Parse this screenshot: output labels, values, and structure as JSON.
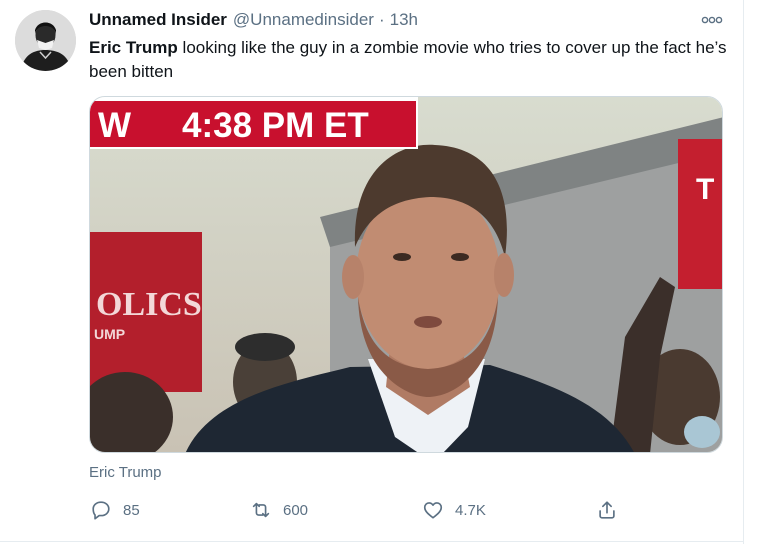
{
  "tweet": {
    "author_name": "Unnamed Insider",
    "author_handle": "@Unnamedinsider",
    "separator": "·",
    "timestamp": "13h",
    "text_bold": "Eric Trump",
    "text_rest": " looking like the guy in a zombie movie who tries to cover up the fact he’s been bitten",
    "media": {
      "banner_prefix": "W",
      "banner_time": "4:38 PM ET",
      "left_sign_text": "OLICS",
      "left_sign_subtext": "UMP",
      "right_sign_text": "T",
      "banner_color": "#c8102e"
    },
    "caption": "Eric Trump",
    "actions": {
      "reply_count": "85",
      "retweet_count": "600",
      "like_count": "4.7K"
    }
  },
  "icons": {
    "more": "more-options-icon",
    "reply": "reply-icon",
    "retweet": "retweet-icon",
    "like": "heart-icon",
    "share": "share-icon"
  },
  "colors": {
    "text_primary": "#0f1419",
    "text_secondary": "#5b7083",
    "divider": "#e6ecf0"
  }
}
